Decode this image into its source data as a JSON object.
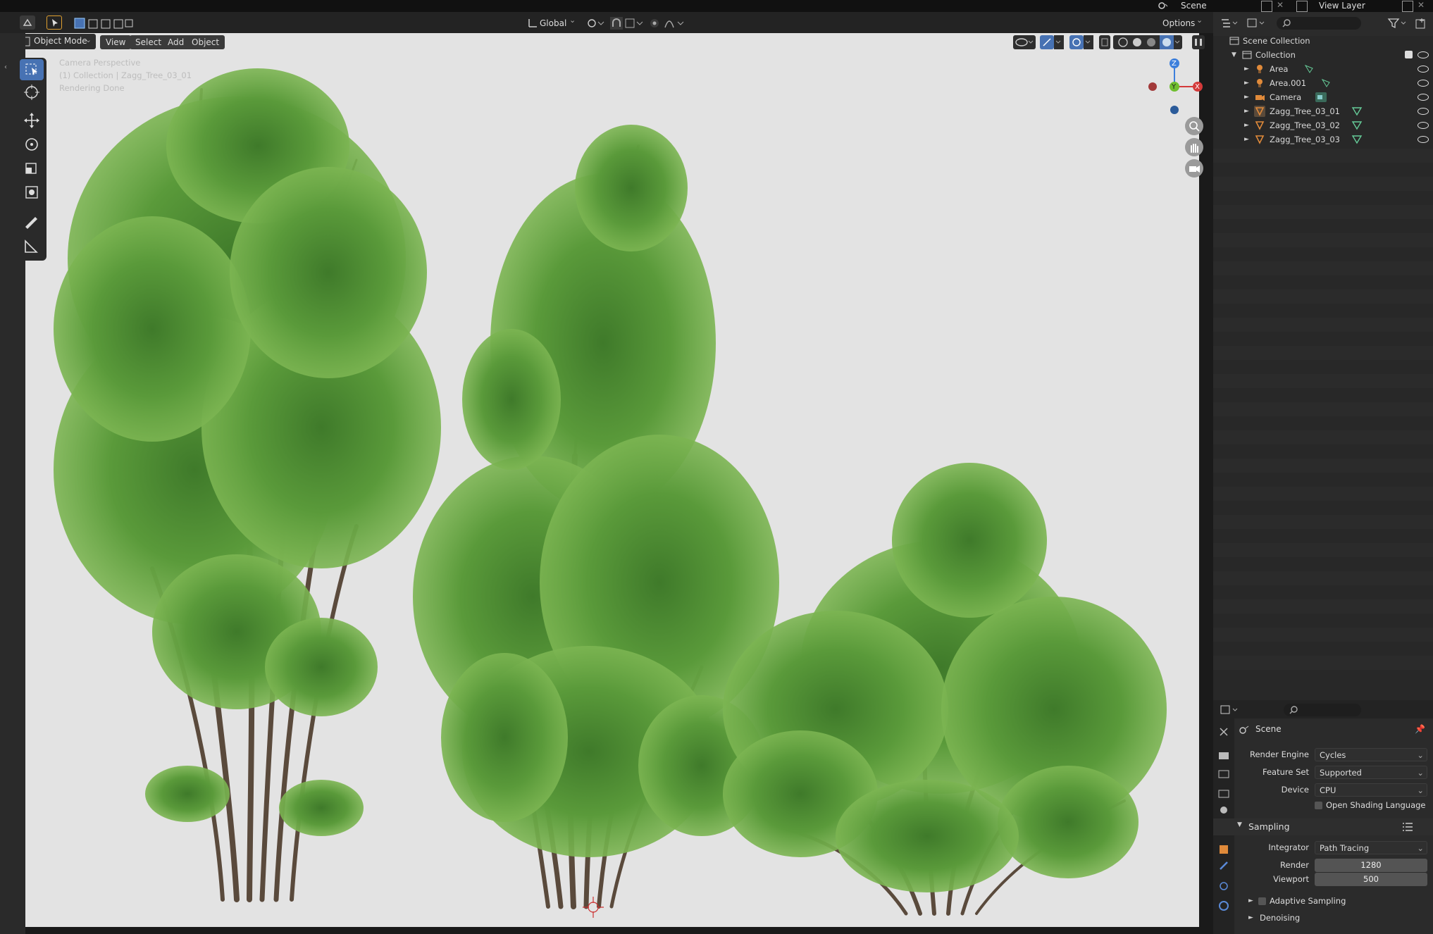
{
  "topbar": {
    "scene": "Scene",
    "view_layer": "View Layer"
  },
  "viewport": {
    "header": {
      "transform_orientation": "Global",
      "options_label": "Options",
      "mode": "Object Mode",
      "menus": [
        "View",
        "Select",
        "Add",
        "Object"
      ]
    },
    "overlay_text": {
      "line1": "Camera Perspective",
      "line2": "(1) Collection | Zagg_Tree_03_01",
      "line3": "Rendering Done"
    },
    "gizmo": {
      "z": "Z",
      "y": "Y",
      "x": "X"
    }
  },
  "outliner": {
    "scene_collection": "Scene Collection",
    "collection": "Collection",
    "items": [
      {
        "label": "Area",
        "type": "light"
      },
      {
        "label": "Area.001",
        "type": "light"
      },
      {
        "label": "Camera",
        "type": "camera"
      },
      {
        "label": "Zagg_Tree_03_01",
        "type": "mesh"
      },
      {
        "label": "Zagg_Tree_03_02",
        "type": "mesh"
      },
      {
        "label": "Zagg_Tree_03_03",
        "type": "mesh"
      }
    ]
  },
  "properties": {
    "context": "Scene",
    "render_engine": {
      "label": "Render Engine",
      "value": "Cycles"
    },
    "feature_set": {
      "label": "Feature Set",
      "value": "Supported"
    },
    "device": {
      "label": "Device",
      "value": "CPU"
    },
    "osl": "Open Shading Language",
    "sampling": {
      "title": "Sampling",
      "integrator": {
        "label": "Integrator",
        "value": "Path Tracing"
      },
      "render": {
        "label": "Render",
        "value": "1280"
      },
      "viewport": {
        "label": "Viewport",
        "value": "500"
      }
    },
    "adaptive_sampling": "Adaptive Sampling",
    "denoising": "Denoising"
  },
  "colors": {
    "accent": "#4772b3",
    "leaf": "#5a9a3a",
    "trunk": "#5a4a3c"
  }
}
